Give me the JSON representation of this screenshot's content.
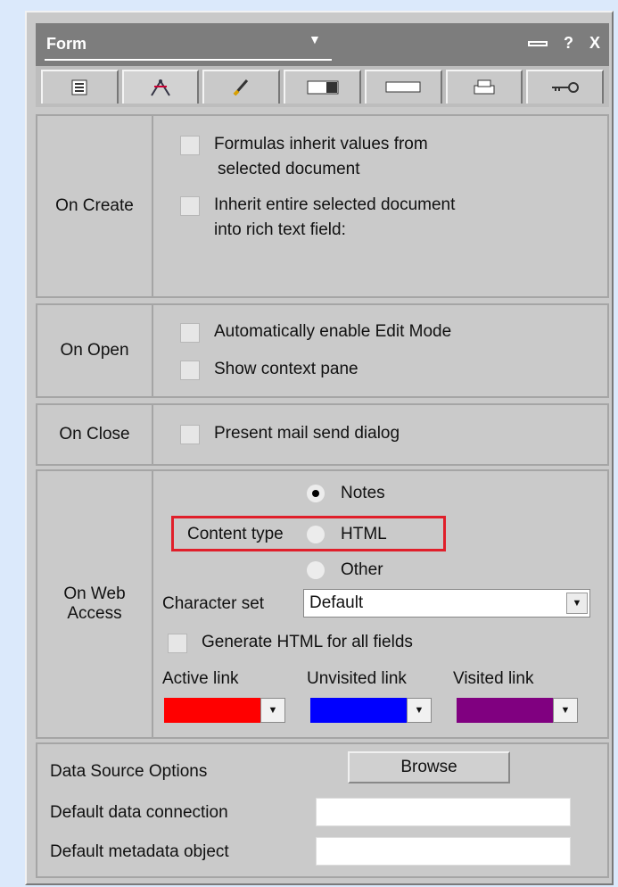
{
  "title": "Form",
  "title_controls": {
    "help": "?",
    "close": "X"
  },
  "tabs": [
    {
      "icon": "info-icon"
    },
    {
      "icon": "fields-icon"
    },
    {
      "icon": "brush-icon"
    },
    {
      "icon": "background-icon"
    },
    {
      "icon": "header-icon"
    },
    {
      "icon": "printer-icon"
    },
    {
      "icon": "key-icon"
    }
  ],
  "on_create": {
    "label": "On Create",
    "option1_line1": "Formulas inherit values from",
    "option1_line2": "selected document",
    "option2_line1": "Inherit entire selected document",
    "option2_line2": "into rich text field:"
  },
  "on_open": {
    "label": "On Open",
    "option1": "Automatically enable Edit Mode",
    "option2": "Show context pane"
  },
  "on_close": {
    "label": "On Close",
    "option1": "Present mail send dialog"
  },
  "on_web_access": {
    "label": "On Web Access",
    "content_type_label": "Content type",
    "content_types": [
      "Notes",
      "HTML",
      "Other"
    ],
    "content_type_selected": "Notes",
    "charset_label": "Character set",
    "charset_value": "Default",
    "generate_html": "Generate HTML for all fields",
    "active_link": "Active link",
    "unvisited_link": "Unvisited link",
    "visited_link": "Visited link",
    "colors": {
      "active": "#ff0000",
      "unvisited": "#0000ff",
      "visited": "#800080",
      "highlight": "#e01f2a"
    }
  },
  "data_source": {
    "label": "Data Source Options",
    "browse": "Browse",
    "connection_label": "Default data connection",
    "connection_value": "",
    "metadata_label": "Default metadata object",
    "metadata_value": ""
  }
}
